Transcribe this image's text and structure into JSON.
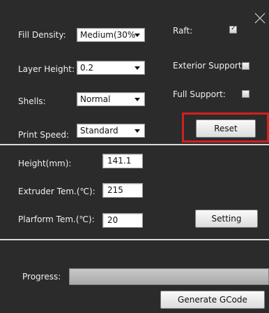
{
  "window": {
    "close_glyph": "✕"
  },
  "settings": {
    "fill_density": {
      "label": "Fill Density:",
      "value": "Medium(30%"
    },
    "layer_height": {
      "label": "Layer Height:",
      "value": "0.2"
    },
    "shells": {
      "label": "Shells:",
      "value": "Normal"
    },
    "print_speed": {
      "label": "Print Speed:",
      "value": "Standard"
    },
    "raft": {
      "label": "Raft:",
      "checked": true
    },
    "exterior_support": {
      "label": "Exterior Support:",
      "checked": false
    },
    "full_support": {
      "label": "Full Support:",
      "checked": false
    },
    "reset_label": "Reset",
    "highlight_color": "#d12020"
  },
  "temps": {
    "height": {
      "label": "Height(mm):",
      "value": "141.1"
    },
    "extruder": {
      "label": "Extruder Tem.(℃):",
      "value": "215"
    },
    "platform": {
      "label": "Plarform Tem.(℃):",
      "value": "20"
    },
    "setting_label": "Setting"
  },
  "progress": {
    "label": "Progress:",
    "fraction": 0,
    "generate_label": "Generate GCode"
  }
}
